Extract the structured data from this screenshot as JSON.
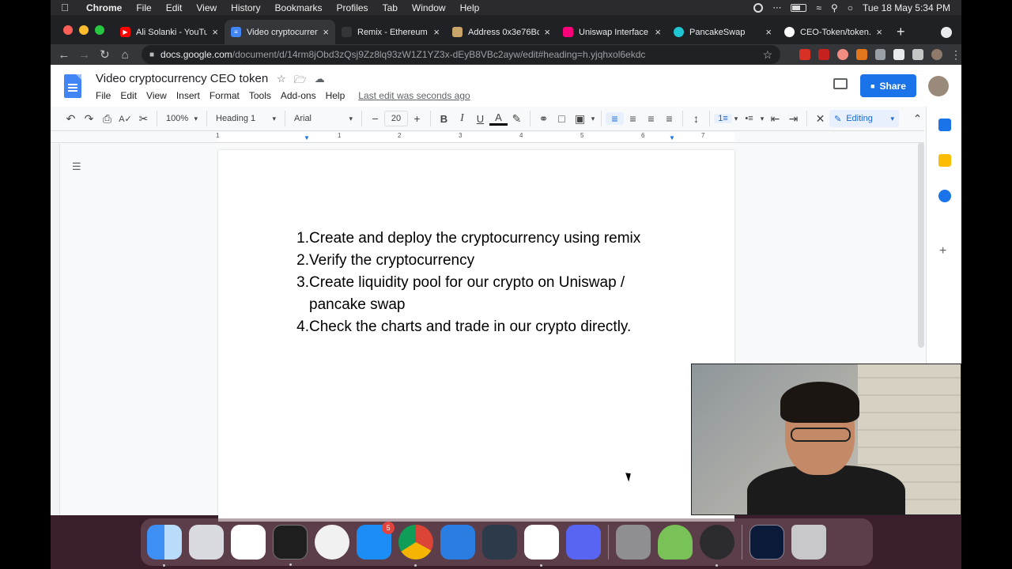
{
  "menubar": {
    "app": "Chrome",
    "items": [
      "File",
      "Edit",
      "View",
      "History",
      "Bookmarks",
      "Profiles",
      "Tab",
      "Window",
      "Help"
    ],
    "clock": "Tue 18 May  5:34 PM"
  },
  "tabs": [
    {
      "label": "Ali Solanki - YouTube",
      "active": false,
      "favicon_color": "#ff0000"
    },
    {
      "label": "Video cryptocurrency CEO token",
      "active": true,
      "favicon_color": "#4285f4"
    },
    {
      "label": "Remix - Ethereum IDE",
      "active": false,
      "favicon_color": "#35363a"
    },
    {
      "label": "Address 0x3e76Bc",
      "active": false,
      "favicon_color": "#c9a56a"
    },
    {
      "label": "Uniswap Interface",
      "active": false,
      "favicon_color": "#ff007a"
    },
    {
      "label": "PancakeSwap",
      "active": false,
      "favicon_color": "#1fc7d4"
    },
    {
      "label": "CEO-Token/token.sol",
      "active": false,
      "favicon_color": "#ffffff"
    }
  ],
  "address": {
    "host": "docs.google.com",
    "path": "/document/d/14rm8jObd3zQsj9Zz8lq93zW1Z1YZ3x-dEyB8VBc2ayw/edit#heading=h.yjqhxol6ekdc"
  },
  "docs": {
    "title": "Video cryptocurrency CEO token",
    "menu": [
      "File",
      "Edit",
      "View",
      "Insert",
      "Format",
      "Tools",
      "Add-ons",
      "Help"
    ],
    "last_edit": "Last edit was seconds ago",
    "share_label": "Share",
    "toolbar": {
      "zoom": "100%",
      "style": "Heading 1",
      "font": "Arial",
      "font_size": "20",
      "mode": "Editing"
    },
    "ruler_numbers": [
      "1",
      "1",
      "2",
      "3",
      "4",
      "5",
      "6",
      "7"
    ],
    "list": [
      {
        "num": "1.",
        "text": "Create and deploy the cryptocurrency using remix"
      },
      {
        "num": "2.",
        "text": "Verify the cryptocurrency"
      },
      {
        "num": "3.",
        "text": "Create liquidity pool for our crypto on Uniswap / pancake swap"
      },
      {
        "num": "4.",
        "text": "Check the charts and trade in our crypto directly."
      }
    ]
  },
  "dock": {
    "apps": [
      "Finder",
      "Launchpad",
      "Reminders",
      "Terminal",
      "Xcode Instruments",
      "App Store",
      "Google Chrome",
      "Xcode",
      "DaVinci Resolve",
      "Visual Studio Code",
      "Discord",
      "System Preferences",
      "Android Studio",
      "Proxyman",
      "Brave",
      "Trash"
    ],
    "app_store_badge": "5"
  }
}
